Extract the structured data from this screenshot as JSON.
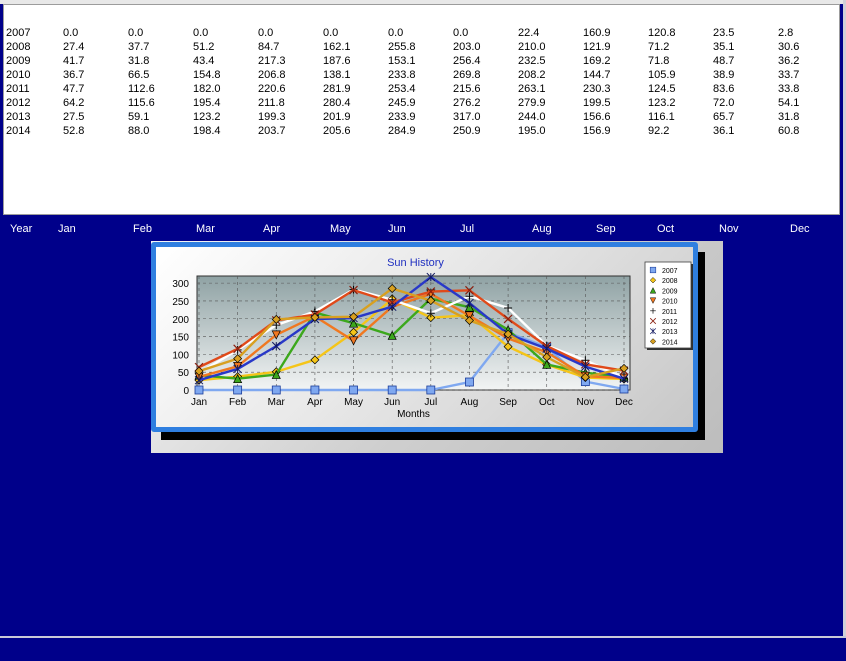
{
  "table": {
    "rows": [
      {
        "year": "2007",
        "values": [
          "0.0",
          "0.0",
          "0.0",
          "0.0",
          "0.0",
          "0.0",
          "0.0",
          "22.4",
          "160.9",
          "120.8",
          "23.5",
          "2.8"
        ]
      },
      {
        "year": "2008",
        "values": [
          "27.4",
          "37.7",
          "51.2",
          "84.7",
          "162.1",
          "255.8",
          "203.0",
          "210.0",
          "121.9",
          "71.2",
          "35.1",
          "30.6"
        ]
      },
      {
        "year": "2009",
        "values": [
          "41.7",
          "31.8",
          "43.4",
          "217.3",
          "187.6",
          "153.1",
          "256.4",
          "232.5",
          "169.2",
          "71.8",
          "48.7",
          "36.2"
        ]
      },
      {
        "year": "2010",
        "values": [
          "36.7",
          "66.5",
          "154.8",
          "206.8",
          "138.1",
          "233.8",
          "269.8",
          "208.2",
          "144.7",
          "105.9",
          "38.9",
          "33.7"
        ]
      },
      {
        "year": "2011",
        "values": [
          "47.7",
          "112.6",
          "182.0",
          "220.6",
          "281.9",
          "253.4",
          "215.6",
          "263.1",
          "230.3",
          "124.5",
          "83.6",
          "33.8"
        ]
      },
      {
        "year": "2012",
        "values": [
          "64.2",
          "115.6",
          "195.4",
          "211.8",
          "280.4",
          "245.9",
          "276.2",
          "279.9",
          "199.5",
          "123.2",
          "72.0",
          "54.1"
        ]
      },
      {
        "year": "2013",
        "values": [
          "27.5",
          "59.1",
          "123.2",
          "199.3",
          "201.9",
          "233.9",
          "317.0",
          "244.0",
          "156.6",
          "116.1",
          "65.7",
          "31.8"
        ]
      },
      {
        "year": "2014",
        "values": [
          "52.8",
          "88.0",
          "198.4",
          "203.7",
          "205.6",
          "284.9",
          "250.9",
          "195.0",
          "156.9",
          "92.2",
          "36.1",
          "60.8"
        ]
      }
    ]
  },
  "header_row": {
    "year_label": "Year",
    "months": [
      "Jan",
      "Feb",
      "Mar",
      "Apr",
      "May",
      "Jun",
      "Jul",
      "Aug",
      "Sep",
      "Oct",
      "Nov",
      "Dec"
    ]
  },
  "chart_data": {
    "type": "line",
    "title": "Sun History",
    "xlabel": "Months",
    "ylabel": "",
    "categories": [
      "Jan",
      "Feb",
      "Mar",
      "Apr",
      "May",
      "Jun",
      "Jul",
      "Aug",
      "Sep",
      "Oct",
      "Nov",
      "Dec"
    ],
    "ylim": [
      0,
      320
    ],
    "yticks": [
      "0",
      "50",
      "100",
      "150",
      "200",
      "250",
      "300"
    ],
    "grid": true,
    "legend_position": "right",
    "series": [
      {
        "name": "2007",
        "color": "#7fa8f0",
        "values": [
          0.0,
          0.0,
          0.0,
          0.0,
          0.0,
          0.0,
          0.0,
          22.4,
          160.9,
          120.8,
          23.5,
          2.8
        ]
      },
      {
        "name": "2008",
        "color": "#f5c518",
        "values": [
          27.4,
          37.7,
          51.2,
          84.7,
          162.1,
          255.8,
          203.0,
          210.0,
          121.9,
          71.2,
          35.1,
          30.6
        ]
      },
      {
        "name": "2009",
        "color": "#3ca81c",
        "values": [
          41.7,
          31.8,
          43.4,
          217.3,
          187.6,
          153.1,
          256.4,
          232.5,
          169.2,
          71.8,
          48.7,
          36.2
        ]
      },
      {
        "name": "2010",
        "color": "#f07820",
        "values": [
          36.7,
          66.5,
          154.8,
          206.8,
          138.1,
          233.8,
          269.8,
          208.2,
          144.7,
          105.9,
          38.9,
          33.7
        ]
      },
      {
        "name": "2011",
        "color": "#ffffff",
        "values": [
          47.7,
          112.6,
          182.0,
          220.6,
          281.9,
          253.4,
          215.6,
          263.1,
          230.3,
          124.5,
          83.6,
          33.8
        ]
      },
      {
        "name": "2012",
        "color": "#e04a1a",
        "values": [
          64.2,
          115.6,
          195.4,
          211.8,
          280.4,
          245.9,
          276.2,
          279.9,
          199.5,
          123.2,
          72.0,
          54.1
        ]
      },
      {
        "name": "2013",
        "color": "#2838c8",
        "values": [
          27.5,
          59.1,
          123.2,
          199.3,
          201.9,
          233.9,
          317.0,
          244.0,
          156.6,
          116.1,
          65.7,
          31.8
        ]
      },
      {
        "name": "2014",
        "color": "#d8a020",
        "values": [
          52.8,
          88.0,
          198.4,
          203.7,
          205.6,
          284.9,
          250.9,
          195.0,
          156.9,
          92.2,
          36.1,
          60.8
        ]
      }
    ]
  }
}
